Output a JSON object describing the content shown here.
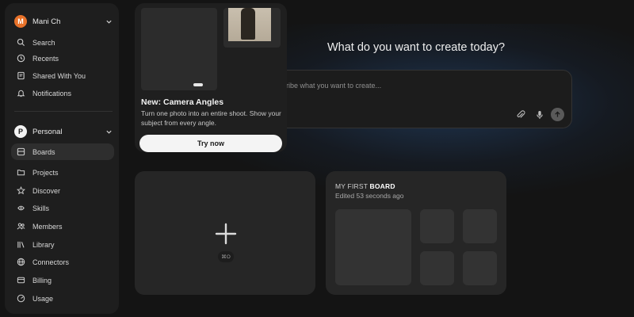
{
  "sidebar": {
    "user": {
      "initial": "M",
      "name": "Mani Ch"
    },
    "top_items": [
      {
        "label": "Search",
        "icon": "search-icon"
      },
      {
        "label": "Recents",
        "icon": "clock-icon"
      },
      {
        "label": "Shared With You",
        "icon": "shared-icon"
      },
      {
        "label": "Notifications",
        "icon": "bell-icon"
      }
    ],
    "workspace": {
      "initial": "P",
      "name": "Personal"
    },
    "items": [
      {
        "label": "Boards",
        "icon": "boards-icon",
        "active": true
      },
      {
        "label": "Projects",
        "icon": "folder-icon"
      },
      {
        "label": "Discover",
        "icon": "star-icon"
      },
      {
        "label": "Skills",
        "icon": "skills-icon"
      },
      {
        "label": "Members",
        "icon": "members-icon"
      },
      {
        "label": "Library",
        "icon": "library-icon"
      },
      {
        "label": "Connectors",
        "icon": "globe-icon"
      },
      {
        "label": "Billing",
        "icon": "billing-icon"
      },
      {
        "label": "Usage",
        "icon": "usage-icon"
      }
    ]
  },
  "promo": {
    "title": "New: Camera Angles",
    "description": "Turn one photo into an entire shoot. Show your subject from every angle.",
    "button_label": "Try now"
  },
  "main": {
    "heading": "What do you want to create today?",
    "prompt_placeholder": "ribe what you want to create..."
  },
  "boards": {
    "new_shortcut": "⌘O",
    "first": {
      "title_prefix": "MY FIRST",
      "title_bold": "BOARD",
      "edited": "Edited 53 seconds ago"
    }
  },
  "colors": {
    "accent_avatar": "#e8722a",
    "background": "#141414",
    "panel": "#1e1e1e"
  }
}
